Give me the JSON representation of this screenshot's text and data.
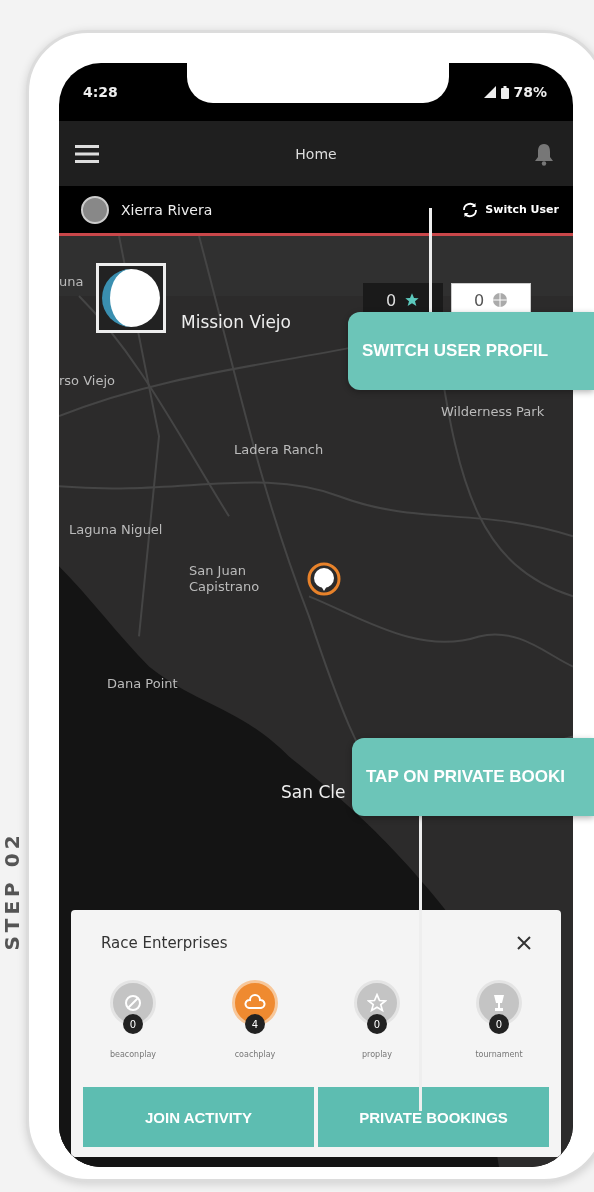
{
  "side_caption": "STEP 02",
  "status_bar": {
    "time": "4:28",
    "battery": "78%"
  },
  "app_bar": {
    "title": "Home"
  },
  "user_bar": {
    "name": "Xierra Rivera",
    "switch_label": "Switch User"
  },
  "counters": [
    {
      "kind": "star",
      "value": "0"
    },
    {
      "kind": "ball",
      "value": "0"
    }
  ],
  "map_labels": [
    "una",
    "Mission Viejo",
    "rso Viejo",
    "Wilderness Park",
    "Ladera Ranch",
    "Laguna Niguel",
    "San Juan Capistrano",
    "Dana Point",
    "San Cle"
  ],
  "sheet": {
    "title": "Race Enterprises",
    "categories": [
      {
        "label": "beaconplay",
        "count": "0",
        "selected": false
      },
      {
        "label": "coachplay",
        "count": "4",
        "selected": true
      },
      {
        "label": "proplay",
        "count": "0",
        "selected": false
      },
      {
        "label": "tournament",
        "count": "0",
        "selected": false
      }
    ],
    "buttons": [
      "JOIN ACTIVITY",
      "PRIVATE BOOKINGS"
    ]
  },
  "callouts": [
    "SWITCH USER PROFIL",
    "TAP ON PRIVATE BOOKI"
  ]
}
